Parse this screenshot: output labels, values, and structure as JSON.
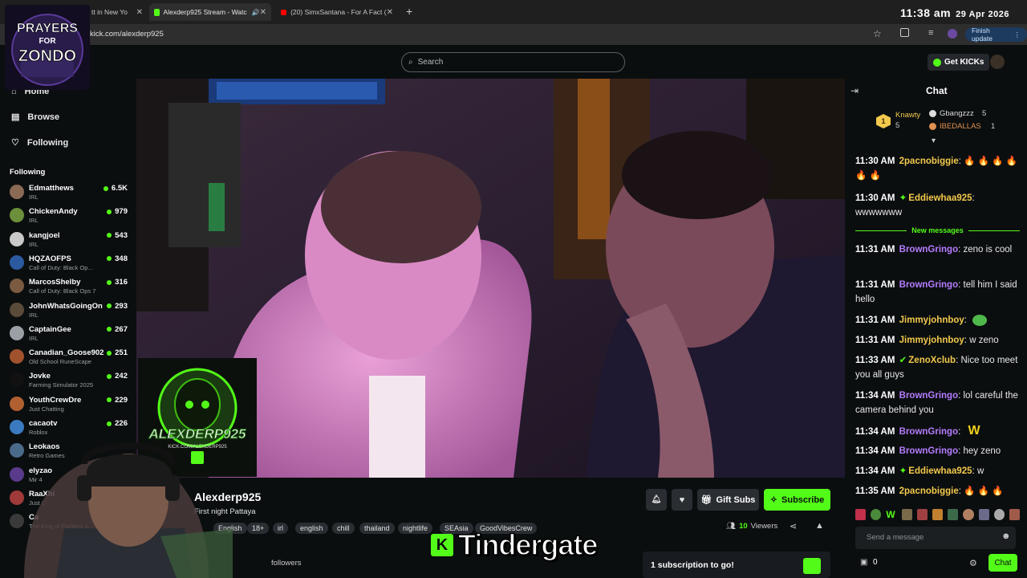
{
  "browser": {
    "tabs": [
      {
        "label": "tt in New Yo",
        "active": false
      },
      {
        "label": "Alexderp925 Stream - Watc",
        "active": true
      },
      {
        "label": "(20) SimxSantana - For A Fact (",
        "active": false
      }
    ],
    "url": "kick.com/alexderp925",
    "finish_update": "Finish update",
    "clock_time": "11:38 am",
    "clock_date": "29 Apr 2026"
  },
  "overlay_logo": {
    "line1": "PRAYERS",
    "line2": "FOR",
    "line3": "ZONDO"
  },
  "header": {
    "search_placeholder": "Search",
    "get_kicks": "Get KICKs"
  },
  "sidebar": {
    "nav": [
      {
        "label": "Home",
        "icon": "home-icon"
      },
      {
        "label": "Browse",
        "icon": "browse-icon"
      },
      {
        "label": "Following",
        "icon": "heart-icon"
      }
    ],
    "following_title": "Following",
    "channels": [
      {
        "name": "Edmatthews",
        "category": "IRL",
        "viewers": "6.5K",
        "color": "#8a6a55"
      },
      {
        "name": "ChickenAndy",
        "category": "IRL",
        "viewers": "979",
        "color": "#6b8f3a"
      },
      {
        "name": "kangjoel",
        "category": "IRL",
        "viewers": "543",
        "color": "#c9c9c9"
      },
      {
        "name": "HQZAOFPS",
        "category": "Call of Duty: Black Op...",
        "viewers": "348",
        "color": "#2c5aa0"
      },
      {
        "name": "MarcosShelby",
        "category": "Call of Duty: Black Ops 7",
        "viewers": "316",
        "color": "#7a5a40"
      },
      {
        "name": "JohnWhatsGoingOn",
        "category": "IRL",
        "viewers": "293",
        "color": "#5a4a3a"
      },
      {
        "name": "CaptainGee",
        "category": "IRL",
        "viewers": "267",
        "color": "#9aa0a6"
      },
      {
        "name": "Canadian_Goose902",
        "category": "Old School RuneScape",
        "viewers": "251",
        "color": "#a0522d"
      },
      {
        "name": "Jovke",
        "category": "Farming Simulator 2025",
        "viewers": "242",
        "color": "#111111"
      },
      {
        "name": "YouthCrewDre",
        "category": "Just Chatting",
        "viewers": "229",
        "color": "#b06030"
      },
      {
        "name": "cacaotv",
        "category": "Roblox",
        "viewers": "226",
        "color": "#3a7ac0"
      },
      {
        "name": "Leokaos",
        "category": "Retro Games",
        "viewers": "",
        "color": "#4a6a8a"
      },
      {
        "name": "elyzao",
        "category": "Mir 4",
        "viewers": "",
        "color": "#5a3a8a"
      },
      {
        "name": "RaaXhi",
        "category": "Just C",
        "viewers": "",
        "color": "#a03a3a"
      },
      {
        "name": "Ca",
        "category": "The King of Fighters 2...",
        "viewers": "",
        "color": "#3a3a3a"
      }
    ]
  },
  "badge_overlay": {
    "name": "ALEXDERP925",
    "url": "KICK.COM/ALEXDERP925"
  },
  "stream": {
    "streamer": "Alexderp925",
    "title": "First night Pattaya",
    "tags": [
      "English",
      "18+",
      "irl",
      "english",
      "chill",
      "thailand",
      "nightlife",
      "SEAsia",
      "GoodVibesCrew"
    ],
    "gift_subs": "Gift Subs",
    "subscribe": "Subscribe",
    "viewers_count": "10",
    "viewers_label": "Viewers",
    "followers_label": "followers",
    "sub_goal": "1 subscription to go!",
    "caption": "Tindergate"
  },
  "chat": {
    "title": "Chat",
    "leaderboard": [
      {
        "rank": "1",
        "name": "Knawty",
        "count": "5"
      },
      {
        "name": "Gbangzzz",
        "count": "5"
      },
      {
        "name": "IBEDALLAS",
        "count": "1"
      }
    ],
    "new_messages": "New messages",
    "messages": [
      {
        "time": "11:30 AM",
        "user": "2pacnobiggie",
        "color": "u-yellow",
        "text": "🔥 🔥 🔥 🔥 🔥 🔥"
      },
      {
        "time": "11:30 AM",
        "user": "Eddiewhaa925",
        "color": "u-yellow",
        "text": "wwwwwww"
      },
      {
        "time": "11:31 AM",
        "user": "BrownGringo",
        "color": "u-purple",
        "text": "zeno is cool"
      },
      {
        "time": "11:31 AM",
        "user": "BrownGringo",
        "color": "u-purple",
        "text": "tell him I said hello"
      },
      {
        "time": "11:31 AM",
        "user": "Jimmyjohnboy",
        "color": "u-yellow",
        "text": ""
      },
      {
        "time": "11:31 AM",
        "user": "Jimmyjohnboy",
        "color": "u-yellow",
        "text": "w zeno"
      },
      {
        "time": "11:33 AM",
        "user": "ZenoXclub",
        "color": "u-yellow",
        "text": "Nice too meet you all guys"
      },
      {
        "time": "11:34 AM",
        "user": "BrownGringo",
        "color": "u-purple",
        "text": "lol careful the camera behind you"
      },
      {
        "time": "11:34 AM",
        "user": "BrownGringo",
        "color": "u-purple",
        "text": ""
      },
      {
        "time": "11:34 AM",
        "user": "BrownGringo",
        "color": "u-purple",
        "text": "hey zeno"
      },
      {
        "time": "11:34 AM",
        "user": "Eddiewhaa925",
        "color": "u-yellow",
        "text": "w"
      },
      {
        "time": "11:35 AM",
        "user": "2pacnobiggie",
        "color": "u-yellow",
        "text": "🔥 🔥 🔥"
      }
    ],
    "input_placeholder": "Send a message",
    "points": "0",
    "send_label": "Chat"
  }
}
